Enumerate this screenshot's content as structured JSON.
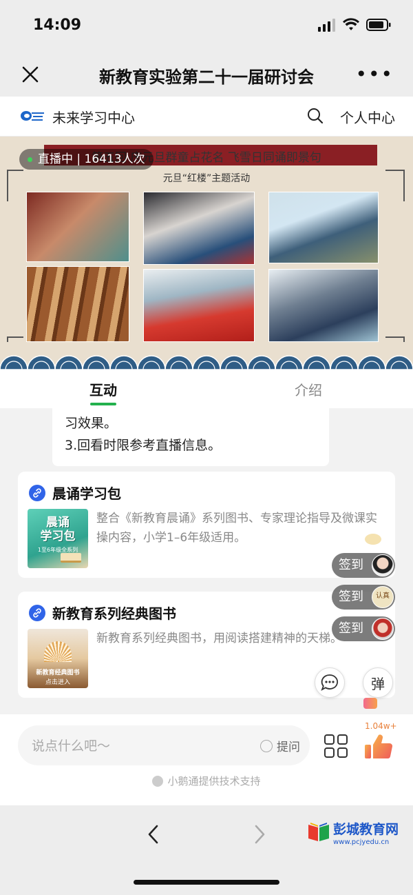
{
  "status": {
    "time": "14:09"
  },
  "window": {
    "title": "新教育实验第二十一届研讨会"
  },
  "brand": {
    "name": "未来学习中心",
    "user_center": "个人中心"
  },
  "video": {
    "live_label": "直播中 | 16413人次",
    "slide_title": "第五回 庆元旦群童占花名  飞雪日同诵即景句",
    "slide_subtitle": "元旦“红楼”主题活动"
  },
  "tabs": [
    {
      "label": "互动",
      "active": true
    },
    {
      "label": "介绍",
      "active": false
    }
  ],
  "notice": {
    "lines": [
      "习效果。",
      "3.回看时限参考直播信息。"
    ]
  },
  "cards": [
    {
      "title": "晨诵学习包",
      "description": "整合《新教育晨诵》系列图书、专家理论指导及微课实操内容，小学1–6年级适用。",
      "thumb_big": "晨诵\n学习包",
      "thumb_small": "1至6年级全系列"
    },
    {
      "title": "新教育系列经典图书",
      "description": "新教育系列经典图书，用阅读搭建精神的天梯。",
      "thumb_title": "新教育经典图书",
      "thumb_cta": "点击进入"
    }
  ],
  "checkins": [
    {
      "label": "签到"
    },
    {
      "label": "签到",
      "avatar_text": "认真"
    },
    {
      "label": "签到"
    }
  ],
  "danmu_label": "弹",
  "input": {
    "placeholder": "说点什么吧～",
    "ask_label": "提问"
  },
  "likes": {
    "count": "1.04w+"
  },
  "support_text": "小鹅通提供技术支持",
  "watermark": {
    "title": "彭城教育网",
    "url": "www.pcjyedu.cn"
  },
  "colors": {
    "accent": "#23b14d",
    "link": "#3064e8",
    "banner": "#8a1f24"
  }
}
